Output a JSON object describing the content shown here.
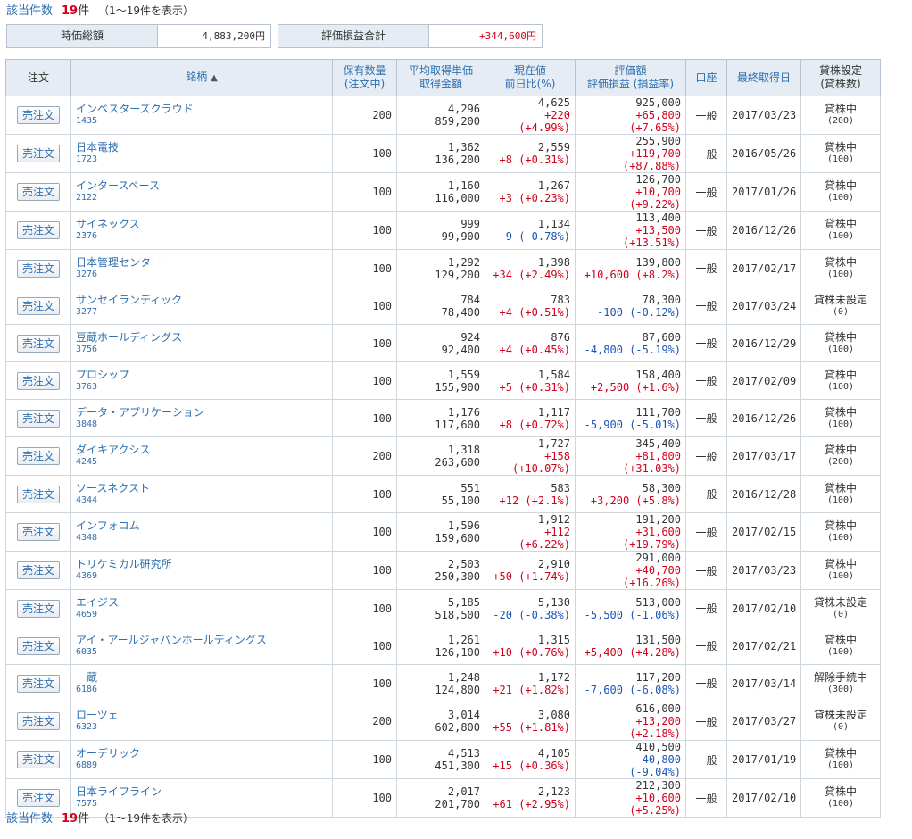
{
  "count": {
    "label": "該当件数",
    "num": "19",
    "unit": "件",
    "range": "（1〜19件を表示）"
  },
  "summary": [
    {
      "label": "時価総額",
      "value": "4,883,200円",
      "tone": ""
    },
    {
      "label": "評価損益合計",
      "value": "+344,600円",
      "tone": "pos"
    }
  ],
  "headers": {
    "order": "注文",
    "name": "銘柄",
    "name_sort": "▲",
    "qty": [
      "保有数量",
      "(注文中)"
    ],
    "avg": [
      "平均取得単価",
      "取得金額"
    ],
    "price": [
      "現在値",
      "前日比(%)"
    ],
    "value": [
      "評価額",
      "評価損益 (損益率)"
    ],
    "account": "口座",
    "date": "最終取得日",
    "lend": [
      "貸株設定",
      "(貸株数)"
    ]
  },
  "sell_label": "売注文",
  "rows": [
    {
      "name": "インベスターズクラウド",
      "code": "1435",
      "qty": "200",
      "avg": "4,296",
      "cost": "859,200",
      "price": "4,625",
      "chg": "+220 (+4.99%)",
      "chg_tone": "pos",
      "val": "925,000",
      "pl": "+65,800 (+7.65%)",
      "pl_tone": "pos",
      "acct": "一般",
      "date": "2017/03/23",
      "lend": "貸株中",
      "lend_n": "(200)"
    },
    {
      "name": "日本電技",
      "code": "1723",
      "qty": "100",
      "avg": "1,362",
      "cost": "136,200",
      "price": "2,559",
      "chg": "+8 (+0.31%)",
      "chg_tone": "pos",
      "val": "255,900",
      "pl": "+119,700 (+87.88%)",
      "pl_tone": "pos",
      "acct": "一般",
      "date": "2016/05/26",
      "lend": "貸株中",
      "lend_n": "(100)"
    },
    {
      "name": "インタースペース",
      "code": "2122",
      "qty": "100",
      "avg": "1,160",
      "cost": "116,000",
      "price": "1,267",
      "chg": "+3 (+0.23%)",
      "chg_tone": "pos",
      "val": "126,700",
      "pl": "+10,700 (+9.22%)",
      "pl_tone": "pos",
      "acct": "一般",
      "date": "2017/01/26",
      "lend": "貸株中",
      "lend_n": "(100)"
    },
    {
      "name": "サイネックス",
      "code": "2376",
      "qty": "100",
      "avg": "999",
      "cost": "99,900",
      "price": "1,134",
      "chg": "-9 (-0.78%)",
      "chg_tone": "neg",
      "val": "113,400",
      "pl": "+13,500 (+13.51%)",
      "pl_tone": "pos",
      "acct": "一般",
      "date": "2016/12/26",
      "lend": "貸株中",
      "lend_n": "(100)"
    },
    {
      "name": "日本管理センター",
      "code": "3276",
      "qty": "100",
      "avg": "1,292",
      "cost": "129,200",
      "price": "1,398",
      "chg": "+34 (+2.49%)",
      "chg_tone": "pos",
      "val": "139,800",
      "pl": "+10,600 (+8.2%)",
      "pl_tone": "pos",
      "acct": "一般",
      "date": "2017/02/17",
      "lend": "貸株中",
      "lend_n": "(100)"
    },
    {
      "name": "サンセイランディック",
      "code": "3277",
      "qty": "100",
      "avg": "784",
      "cost": "78,400",
      "price": "783",
      "chg": "+4 (+0.51%)",
      "chg_tone": "pos",
      "val": "78,300",
      "pl": "-100 (-0.12%)",
      "pl_tone": "neg",
      "acct": "一般",
      "date": "2017/03/24",
      "lend": "貸株未設定",
      "lend_n": "(0)"
    },
    {
      "name": "豆蔵ホールディングス",
      "code": "3756",
      "qty": "100",
      "avg": "924",
      "cost": "92,400",
      "price": "876",
      "chg": "+4 (+0.45%)",
      "chg_tone": "pos",
      "val": "87,600",
      "pl": "-4,800 (-5.19%)",
      "pl_tone": "neg",
      "acct": "一般",
      "date": "2016/12/29",
      "lend": "貸株中",
      "lend_n": "(100)"
    },
    {
      "name": "プロシップ",
      "code": "3763",
      "qty": "100",
      "avg": "1,559",
      "cost": "155,900",
      "price": "1,584",
      "chg": "+5 (+0.31%)",
      "chg_tone": "pos",
      "val": "158,400",
      "pl": "+2,500 (+1.6%)",
      "pl_tone": "pos",
      "acct": "一般",
      "date": "2017/02/09",
      "lend": "貸株中",
      "lend_n": "(100)"
    },
    {
      "name": "データ・アプリケーション",
      "code": "3848",
      "qty": "100",
      "avg": "1,176",
      "cost": "117,600",
      "price": "1,117",
      "chg": "+8 (+0.72%)",
      "chg_tone": "pos",
      "val": "111,700",
      "pl": "-5,900 (-5.01%)",
      "pl_tone": "neg",
      "acct": "一般",
      "date": "2016/12/26",
      "lend": "貸株中",
      "lend_n": "(100)"
    },
    {
      "name": "ダイキアクシス",
      "code": "4245",
      "qty": "200",
      "avg": "1,318",
      "cost": "263,600",
      "price": "1,727",
      "chg": "+158 (+10.07%)",
      "chg_tone": "pos",
      "val": "345,400",
      "pl": "+81,800 (+31.03%)",
      "pl_tone": "pos",
      "acct": "一般",
      "date": "2017/03/17",
      "lend": "貸株中",
      "lend_n": "(200)"
    },
    {
      "name": "ソースネクスト",
      "code": "4344",
      "qty": "100",
      "avg": "551",
      "cost": "55,100",
      "price": "583",
      "chg": "+12 (+2.1%)",
      "chg_tone": "pos",
      "val": "58,300",
      "pl": "+3,200 (+5.8%)",
      "pl_tone": "pos",
      "acct": "一般",
      "date": "2016/12/28",
      "lend": "貸株中",
      "lend_n": "(100)"
    },
    {
      "name": "インフォコム",
      "code": "4348",
      "qty": "100",
      "avg": "1,596",
      "cost": "159,600",
      "price": "1,912",
      "chg": "+112 (+6.22%)",
      "chg_tone": "pos",
      "val": "191,200",
      "pl": "+31,600 (+19.79%)",
      "pl_tone": "pos",
      "acct": "一般",
      "date": "2017/02/15",
      "lend": "貸株中",
      "lend_n": "(100)"
    },
    {
      "name": "トリケミカル研究所",
      "code": "4369",
      "qty": "100",
      "avg": "2,503",
      "cost": "250,300",
      "price": "2,910",
      "chg": "+50 (+1.74%)",
      "chg_tone": "pos",
      "val": "291,000",
      "pl": "+40,700 (+16.26%)",
      "pl_tone": "pos",
      "acct": "一般",
      "date": "2017/03/23",
      "lend": "貸株中",
      "lend_n": "(100)"
    },
    {
      "name": "エイジス",
      "code": "4659",
      "qty": "100",
      "avg": "5,185",
      "cost": "518,500",
      "price": "5,130",
      "chg": "-20 (-0.38%)",
      "chg_tone": "neg",
      "val": "513,000",
      "pl": "-5,500 (-1.06%)",
      "pl_tone": "neg",
      "acct": "一般",
      "date": "2017/02/10",
      "lend": "貸株未設定",
      "lend_n": "(0)"
    },
    {
      "name": "アイ・アールジャパンホールディングス",
      "code": "6035",
      "qty": "100",
      "avg": "1,261",
      "cost": "126,100",
      "price": "1,315",
      "chg": "+10 (+0.76%)",
      "chg_tone": "pos",
      "val": "131,500",
      "pl": "+5,400 (+4.28%)",
      "pl_tone": "pos",
      "acct": "一般",
      "date": "2017/02/21",
      "lend": "貸株中",
      "lend_n": "(100)"
    },
    {
      "name": "一蔵",
      "code": "6186",
      "qty": "100",
      "avg": "1,248",
      "cost": "124,800",
      "price": "1,172",
      "chg": "+21 (+1.82%)",
      "chg_tone": "pos",
      "val": "117,200",
      "pl": "-7,600 (-6.08%)",
      "pl_tone": "neg",
      "acct": "一般",
      "date": "2017/03/14",
      "lend": "解除手続中",
      "lend_n": "(300)"
    },
    {
      "name": "ローツェ",
      "code": "6323",
      "qty": "200",
      "avg": "3,014",
      "cost": "602,800",
      "price": "3,080",
      "chg": "+55 (+1.81%)",
      "chg_tone": "pos",
      "val": "616,000",
      "pl": "+13,200 (+2.18%)",
      "pl_tone": "pos",
      "acct": "一般",
      "date": "2017/03/27",
      "lend": "貸株未設定",
      "lend_n": "(0)"
    },
    {
      "name": "オーデリック",
      "code": "6889",
      "qty": "100",
      "avg": "4,513",
      "cost": "451,300",
      "price": "4,105",
      "chg": "+15 (+0.36%)",
      "chg_tone": "pos",
      "val": "410,500",
      "pl": "-40,800 (-9.04%)",
      "pl_tone": "neg",
      "acct": "一般",
      "date": "2017/01/19",
      "lend": "貸株中",
      "lend_n": "(100)"
    },
    {
      "name": "日本ライフライン",
      "code": "7575",
      "qty": "100",
      "avg": "2,017",
      "cost": "201,700",
      "price": "2,123",
      "chg": "+61 (+2.95%)",
      "chg_tone": "pos",
      "val": "212,300",
      "pl": "+10,600 (+5.25%)",
      "pl_tone": "pos",
      "acct": "一般",
      "date": "2017/02/10",
      "lend": "貸株中",
      "lend_n": "(100)"
    }
  ]
}
